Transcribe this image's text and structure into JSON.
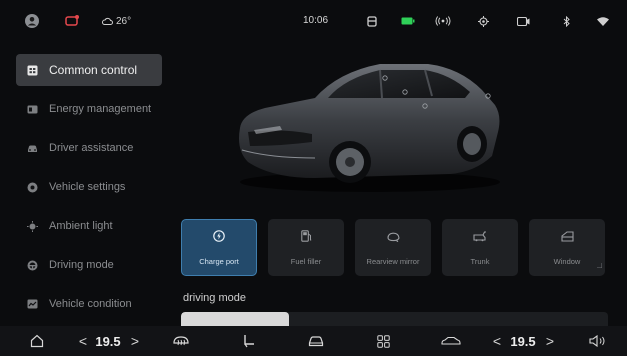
{
  "status_bar": {
    "temperature": "26°",
    "time": "10:06"
  },
  "sidebar": {
    "items": [
      {
        "label": "Common control",
        "icon": "grid-icon",
        "active": true
      },
      {
        "label": "Energy management",
        "icon": "battery-icon",
        "active": false
      },
      {
        "label": "Driver assistance",
        "icon": "car-icon",
        "active": false
      },
      {
        "label": "Vehicle settings",
        "icon": "settings-icon",
        "active": false
      },
      {
        "label": "Ambient light",
        "icon": "light-icon",
        "active": false
      },
      {
        "label": "Driving mode",
        "icon": "steering-icon",
        "active": false
      },
      {
        "label": "Vehicle condition",
        "icon": "monitor-icon",
        "active": false
      }
    ]
  },
  "controls": [
    {
      "label": "Charge port",
      "icon": "charge-port-icon",
      "active": true
    },
    {
      "label": "Fuel filler",
      "icon": "fuel-icon",
      "active": false
    },
    {
      "label": "Rearview mirror",
      "icon": "mirror-icon",
      "active": false
    },
    {
      "label": "Trunk",
      "icon": "trunk-icon",
      "active": false
    },
    {
      "label": "Window",
      "icon": "window-icon",
      "active": false
    }
  ],
  "driving_mode": {
    "title": "driving mode"
  },
  "dock": {
    "left_temp": "19.5",
    "right_temp": "19.5",
    "prev_glyph": "<",
    "next_glyph": ">"
  },
  "colors": {
    "accent": "#3f7eae",
    "active_card": "#234a6b",
    "background": "#0b0c0e"
  }
}
